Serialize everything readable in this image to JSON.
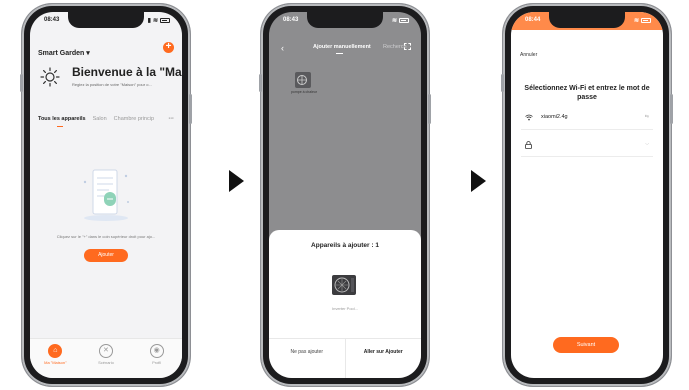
{
  "screen1": {
    "time": "08:43",
    "home_selector": "Smart Garden",
    "welcome": "Bienvenue à la \"Ma...",
    "subtitle": "Reglez la position de votre \"Maison\" pour o...",
    "tabs": [
      {
        "label": "Tous les appareils"
      },
      {
        "label": "Salon"
      },
      {
        "label": "Chambre princip"
      }
    ],
    "more_label": "···",
    "hint": "Cliquez sur le \"+\" dans le coin supérieur droit pour ajo...",
    "add_button": "Ajouter",
    "nav": [
      {
        "label": "Ma \"Maison\"",
        "icon": "home-icon"
      },
      {
        "label": "Scénario",
        "icon": "scene-icon"
      },
      {
        "label": "Profil",
        "icon": "profile-icon"
      }
    ]
  },
  "screen2": {
    "time": "08:43",
    "back_icon": "back-icon",
    "tab_manual": "Ajouter manuellement",
    "tab_search": "Recherch",
    "device_label": "pompe à chaleur",
    "sheet_title": "Appareils à ajouter : 1",
    "sheet_device_name": "Inverter Pool...",
    "btn_skip": "Ne pas ajouter",
    "btn_go": "Aller sur Ajouter"
  },
  "screen3": {
    "time": "08:44",
    "cancel": "Annuler",
    "title": "Sélectionnez Wi-Fi et entrez le mot de passe",
    "wifi_name": "xiaomi2.4g",
    "wifi_end": "⇆",
    "password_value": "",
    "next_button": "Suivant"
  },
  "colors": {
    "accent": "#ff6a1f",
    "overlay": "#8d8d8f"
  }
}
